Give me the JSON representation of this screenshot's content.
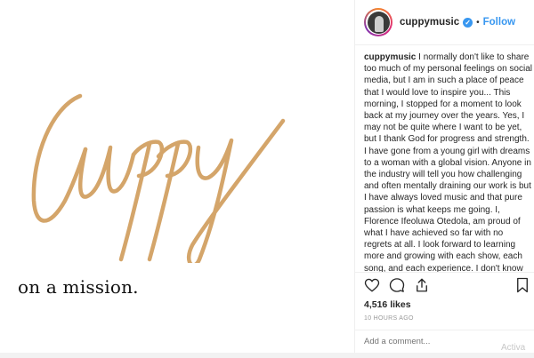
{
  "post": {
    "tagline": "on a mission.",
    "logo_text": "Cuppy",
    "brand_color": "#d4a56a"
  },
  "header": {
    "username": "cuppymusic",
    "separator": "•",
    "follow_label": "Follow",
    "verified_icon": "verified-badge-icon"
  },
  "caption": {
    "author": "cuppymusic",
    "text": "I normally don't like to share too much of my personal feelings on social media, but I am in such a place of peace that I would love to inspire you... This morning, I stopped for a moment to look back at my journey over the years. Yes, I may not be quite where I want to be yet, but I thank God for progress and strength. I have gone from a young girl with dreams to a woman with a global vision. Anyone in the industry will tell you how challenging and often mentally draining our work is but I have always loved music and that pure passion is what keeps me going. I, Florence Ifeoluwa Otedola, am proud of what I have achieved so far with no regrets at all. I look forward to learning more and growing with each show, each song, and each experience. I don't know where my mission will take me but I am loving each day it brings. My dreams have become reality. I'm grateful for every step."
  },
  "engagement": {
    "likes": "4,516 likes",
    "timestamp": "10 HOURS AGO",
    "icons": [
      "heart-icon",
      "comment-icon",
      "share-icon",
      "bookmark-icon"
    ]
  },
  "comment": {
    "placeholder": "Add a comment..."
  },
  "watermark": "Activa",
  "colors": {
    "link_blue": "#3897f0",
    "border": "#efefef",
    "meta_gray": "#999999"
  }
}
